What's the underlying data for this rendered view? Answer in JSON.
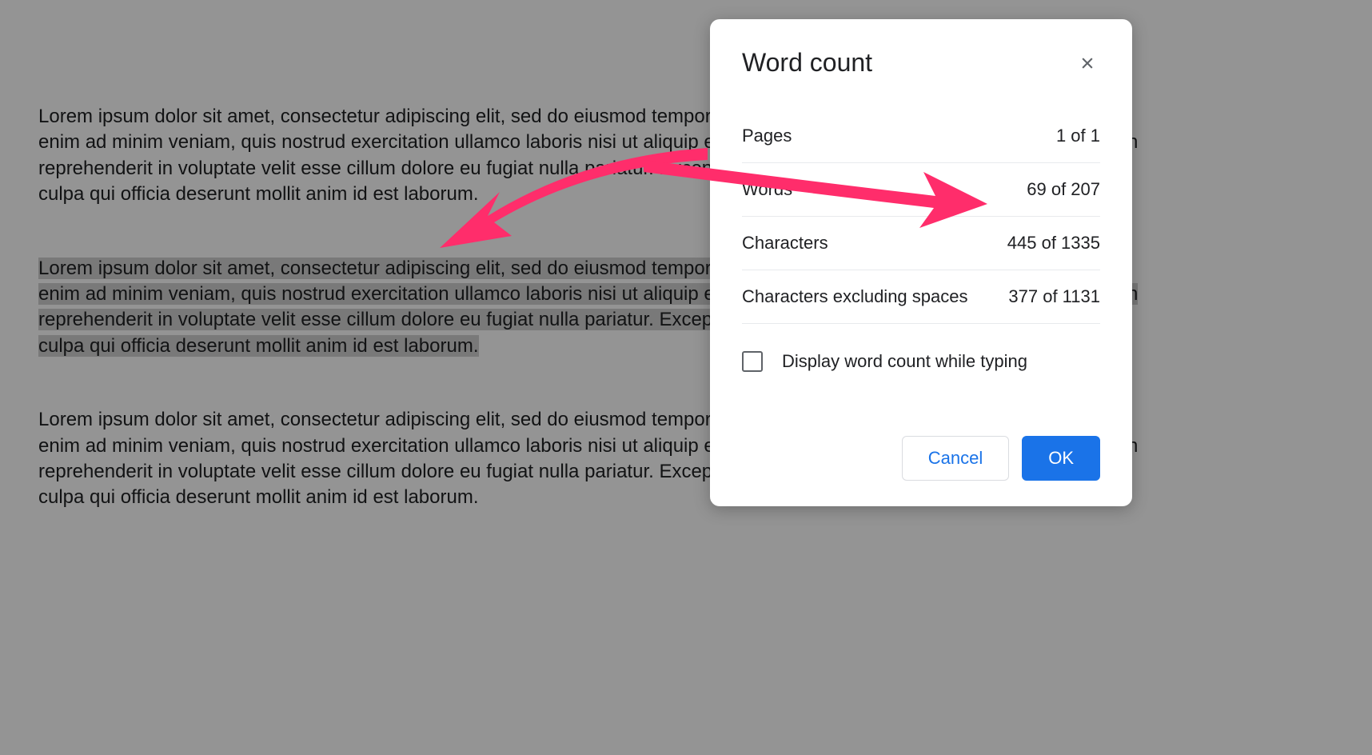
{
  "document": {
    "paragraph1": "Lorem ipsum dolor sit amet, consectetur adipiscing elit, sed do eiusmod tempor incididunt ut labore et dolore magna aliqua. Ut enim ad minim veniam, quis nostrud exercitation ullamco laboris nisi ut aliquip ex ea commodo consequat. Duis aute irure dolor in reprehenderit in voluptate velit esse cillum dolore eu fugiat nulla pariatur. Excepteur sint occaecat cupidatat non proident, sunt in culpa qui officia deserunt mollit anim id est laborum.",
    "paragraph2": "Lorem ipsum dolor sit amet, consectetur adipiscing elit, sed do eiusmod tempor incididunt ut labore et dolore magna aliqua. Ut enim ad minim veniam, quis nostrud exercitation ullamco laboris nisi ut aliquip ex ea commodo consequat. Duis aute irure dolor in reprehenderit in voluptate velit esse cillum dolore eu fugiat nulla pariatur. Excepteur sint occaecat cupidatat non proident, sunt in culpa qui officia deserunt mollit anim id est laborum.",
    "paragraph3": "Lorem ipsum dolor sit amet, consectetur adipiscing elit, sed do eiusmod tempor incididunt ut labore et dolore magna aliqua. Ut enim ad minim veniam, quis nostrud exercitation ullamco laboris nisi ut aliquip ex ea commodo consequat. Duis aute irure dolor in reprehenderit in voluptate velit esse cillum dolore eu fugiat nulla pariatur. Excepteur sint occaecat cupidatat non proident, sunt in culpa qui officia deserunt mollit anim id est laborum."
  },
  "dialog": {
    "title": "Word count",
    "stats": {
      "pages_label": "Pages",
      "pages_value": "1 of 1",
      "words_label": "Words",
      "words_value": "69 of 207",
      "chars_label": "Characters",
      "chars_value": "445 of 1335",
      "chars_ex_label": "Characters excluding spaces",
      "chars_ex_value": "377 of 1131"
    },
    "checkbox_label": "Display word count while typing",
    "cancel_button": "Cancel",
    "ok_button": "OK"
  },
  "annotation": {
    "color": "#ff3366"
  }
}
